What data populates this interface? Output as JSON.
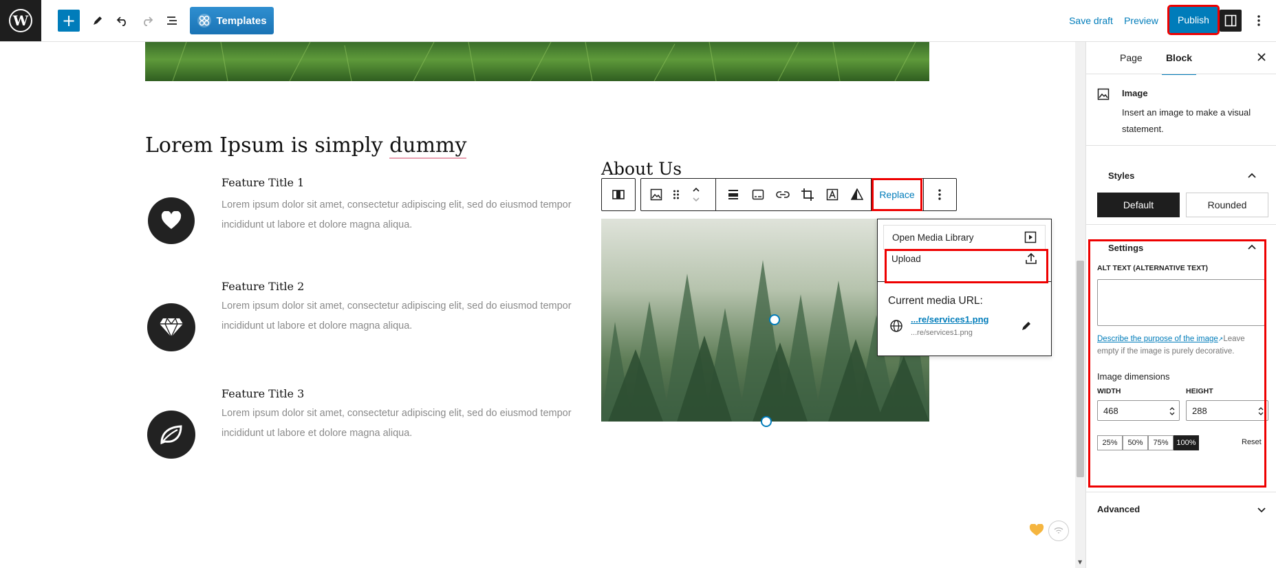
{
  "topbar": {
    "templates_label": "Templates",
    "save_draft": "Save draft",
    "preview": "Preview",
    "publish": "Publish"
  },
  "content": {
    "heading": "Lorem Ipsum is simply ",
    "heading_underlined": "dummy",
    "about_us": "About Us",
    "features": [
      {
        "title": "Feature Title 1",
        "text_line1": "Lorem ipsum dolor sit amet, consectetur adipiscing elit, sed do eiusmod tempor",
        "text_line2": "incididunt ut labore et dolore magna aliqua.",
        "icon": "heart-icon"
      },
      {
        "title": "Feature Title 2",
        "text_line1": "Lorem ipsum dolor sit amet, consectetur adipiscing elit, sed do eiusmod tempor",
        "text_line2": "incididunt ut labore et dolore magna aliqua.",
        "icon": "diamond-icon"
      },
      {
        "title": "Feature Title 3",
        "text_line1": "Lorem ipsum dolor sit amet, consectetur adipiscing elit, sed do eiusmod tempor",
        "text_line2": "incididunt ut labore et dolore magna aliqua.",
        "icon": "leaf-icon"
      }
    ]
  },
  "toolbar": {
    "replace_label": "Replace"
  },
  "replace_menu": {
    "open_media_library": "Open Media Library",
    "upload": "Upload",
    "current_media_url_label": "Current media URL:",
    "url_link": "...re/services1.png",
    "url_sub": "...re/services1.png"
  },
  "sidebar": {
    "tabs": [
      "Page",
      "Block"
    ],
    "active_tab": "Block",
    "block_name": "Image",
    "block_description_line1": "Insert an image to make a visual",
    "block_description_line2": "statement.",
    "styles_title": "Styles",
    "style_default": "Default",
    "style_rounded": "Rounded",
    "settings_title": "Settings",
    "alt_text_label": "ALT TEXT (ALTERNATIVE TEXT)",
    "alt_text_value": "",
    "describe_link": "Describe the purpose of the image",
    "describe_rest1": "Leave",
    "describe_rest2": "empty if the image is purely decorative.",
    "image_dimensions": "Image dimensions",
    "width_label": "WIDTH",
    "height_label": "HEIGHT",
    "width_value": "468",
    "height_value": "288",
    "percent_options": [
      "25%",
      "50%",
      "75%",
      "100%"
    ],
    "percent_selected": "100%",
    "reset": "Reset",
    "advanced_title": "Advanced"
  },
  "colors": {
    "accent": "#007cba",
    "highlight": "#ee0000",
    "dark": "#1e1e1e"
  }
}
